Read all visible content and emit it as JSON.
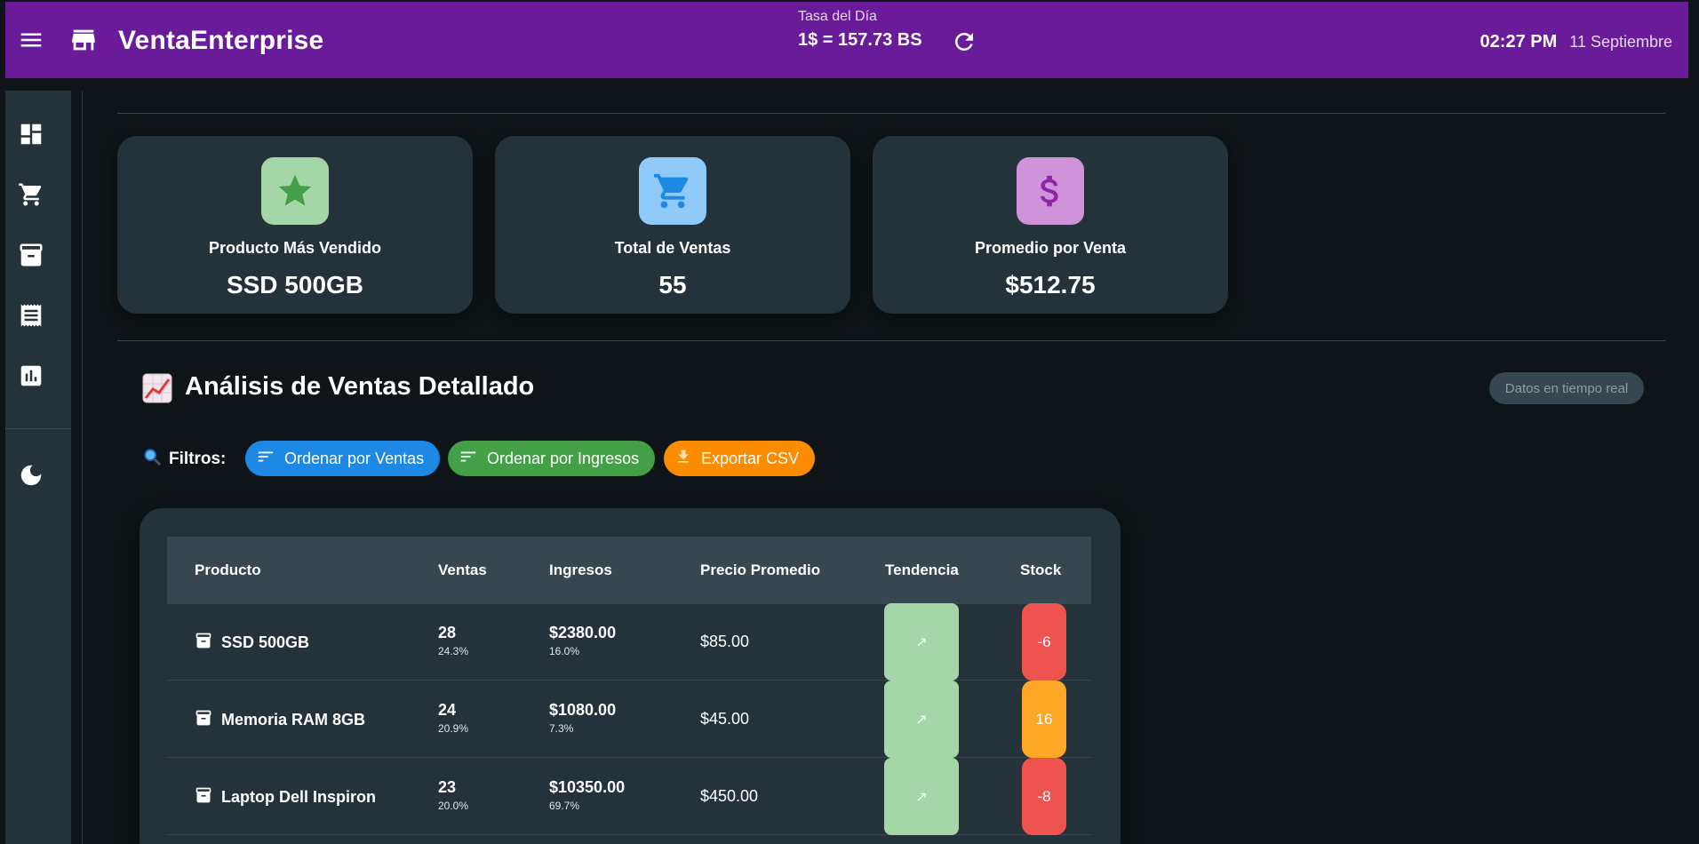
{
  "app": {
    "title": "VentaEnterprise",
    "rate_label": "Tasa del Día",
    "rate_value": "1$ = 157.73 BS",
    "time": "02:27 PM",
    "date": "11 Septiembre"
  },
  "sidebar": {
    "items": [
      {
        "icon": "dashboard-icon"
      },
      {
        "icon": "cart-icon"
      },
      {
        "icon": "inventory-icon"
      },
      {
        "icon": "receipt-icon"
      },
      {
        "icon": "reports-icon"
      },
      {
        "icon": "dark-mode-icon"
      }
    ]
  },
  "stats": [
    {
      "label": "Producto Más Vendido",
      "value": "SSD 500GB",
      "icon": "star-icon",
      "bg": "#a5d6a7",
      "fg": "#43a047"
    },
    {
      "label": "Total de Ventas",
      "value": "55",
      "icon": "cart-icon",
      "bg": "#90caf9",
      "fg": "#1e88e5"
    },
    {
      "label": "Promedio por Venta",
      "value": "$512.75",
      "icon": "dollar-icon",
      "bg": "#ce93d8",
      "fg": "#8e24aa"
    }
  ],
  "analysis": {
    "title": "Análisis de Ventas Detallado",
    "badge": "Datos en tiempo real",
    "filters_label": "Filtros:",
    "chips": [
      {
        "label": "Ordenar por Ventas",
        "color": "#1e88e5"
      },
      {
        "label": "Ordenar por Ingresos",
        "color": "#43a047"
      },
      {
        "label": "Exportar CSV",
        "color": "#fb8c00"
      }
    ]
  },
  "table": {
    "headers": [
      "Producto",
      "Ventas",
      "Ingresos",
      "Precio Promedio",
      "Tendencia",
      "Stock"
    ],
    "rows": [
      {
        "product": "SSD 500GB",
        "sales": "28",
        "sales_pct": "24.3%",
        "revenue": "$2380.00",
        "revenue_pct": "16.0%",
        "avg_price": "$85.00",
        "trend": "↗",
        "stock": "-6",
        "stock_color": "#ef5350"
      },
      {
        "product": "Memoria RAM 8GB",
        "sales": "24",
        "sales_pct": "20.9%",
        "revenue": "$1080.00",
        "revenue_pct": "7.3%",
        "avg_price": "$45.00",
        "trend": "↗",
        "stock": "16",
        "stock_color": "#ffa726"
      },
      {
        "product": "Laptop Dell Inspiron",
        "sales": "23",
        "sales_pct": "20.0%",
        "revenue": "$10350.00",
        "revenue_pct": "69.7%",
        "avg_price": "$450.00",
        "trend": "↗",
        "stock": "-8",
        "stock_color": "#ef5350"
      }
    ]
  },
  "colors": {
    "topbar": "#6a1b9a",
    "surface": "#25323a",
    "background": "#0e1417",
    "trend_bg": "#a5d6a7"
  }
}
